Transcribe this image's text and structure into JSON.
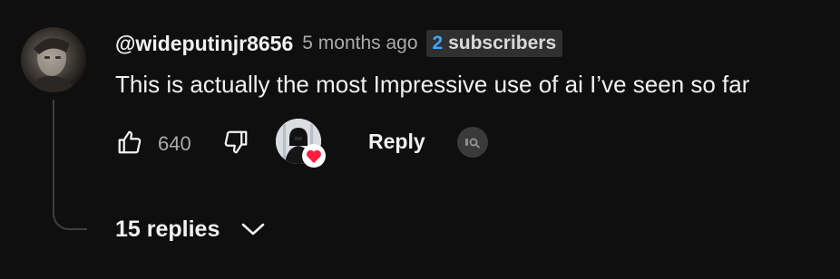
{
  "comment": {
    "author": "@wideputinjr8656",
    "timestamp": "5 months ago",
    "subscriber_count": "2",
    "subscriber_label": "subscribers",
    "text": "This is actually the most Impressive use of ai I’ve seen so far",
    "avatar_icon": "user-avatar-photo"
  },
  "actions": {
    "like_icon": "thumbs-up-icon",
    "like_count": "640",
    "dislike_icon": "thumbs-down-icon",
    "creator_heart_icon": "creator-heart-avatar",
    "reply_label": "Reply",
    "extra_icon": "link-icon"
  },
  "replies": {
    "label": "15 replies",
    "toggle_icon": "chevron-down-icon"
  },
  "colors": {
    "background": "#0f0f0f",
    "text": "#f1f1f1",
    "secondary_text": "#aaaaaa",
    "accent_blue": "#3ea6ff",
    "heart_red": "#ff1f3d",
    "thread_line": "#3f3f3f"
  }
}
